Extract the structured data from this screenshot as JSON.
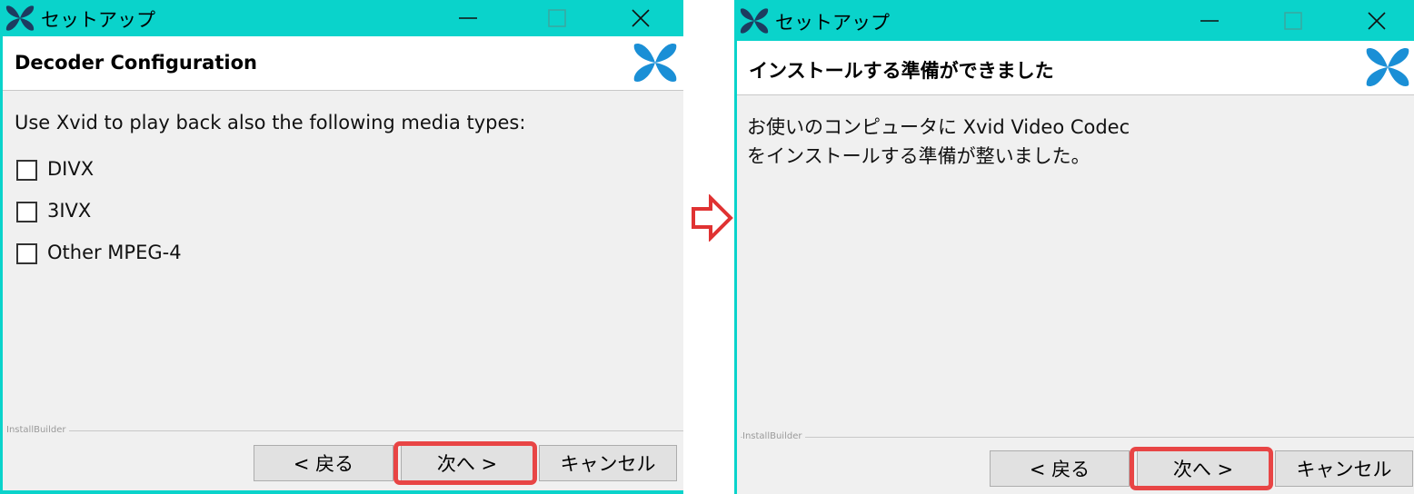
{
  "left_window": {
    "title": "セットアップ",
    "header_title": "Decoder Configuration",
    "prompt": "Use Xvid to play back also the following media types:",
    "options": [
      {
        "label": "DIVX",
        "checked": false
      },
      {
        "label": "3IVX",
        "checked": false
      },
      {
        "label": "Other MPEG-4",
        "checked": false
      }
    ],
    "footer_brand": "InstallBuilder",
    "buttons": {
      "back": "< 戻る",
      "next": "次へ >",
      "cancel": "キャンセル"
    }
  },
  "right_window": {
    "title": "セットアップ",
    "header_title": "インストールする準備ができました",
    "message_line1": "お使いのコンピュータに Xvid Video Codec",
    "message_line2": "をインストールする準備が整いました。",
    "footer_brand": "InstallBuilder",
    "buttons": {
      "back": "< 戻る",
      "next": "次へ >",
      "cancel": "キャンセル"
    }
  },
  "icons": {
    "app": "xvid-logo-icon",
    "minimize": "minimize-icon",
    "maximize": "maximize-icon",
    "close": "close-icon",
    "transition": "right-arrow-icon"
  },
  "colors": {
    "titlebar": "#0ad3cb",
    "logo_blue": "#1a8fd6",
    "logo_dark": "#1d3c60",
    "highlight": "#e84545"
  }
}
